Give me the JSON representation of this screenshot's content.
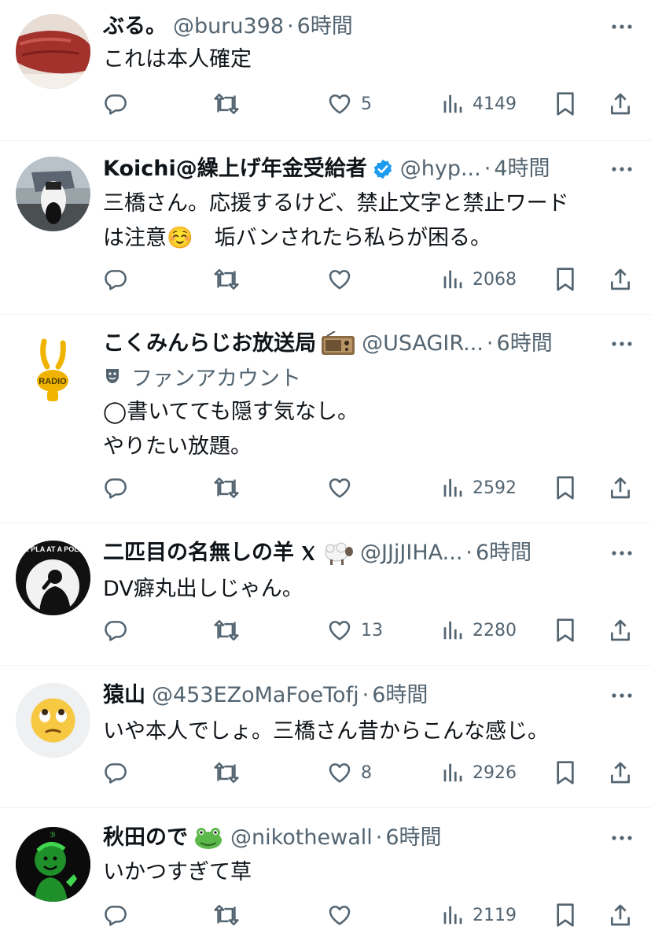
{
  "tweets": [
    {
      "name": "ぶる。",
      "handle": "@buru398",
      "separator": "·",
      "time": "6時間",
      "badge": "",
      "text": "これは本人確定",
      "likes": "5",
      "views": "4149",
      "avatar_icon": "meat-photo-avatar"
    },
    {
      "name": "Koichi@繰上げ年金受給者",
      "handle": "@hyp...",
      "separator": "·",
      "time": "4時間",
      "badge": "verified-badge-icon",
      "text": "三橋さん。応援するけど、禁止文字と禁止ワード\nは注意☺️　垢バンされたら私らが困る。",
      "likes": "",
      "views": "2068",
      "avatar_icon": "motorcycle-photo-avatar"
    },
    {
      "name": "こくみんらじお放送局",
      "handle": "@USAGIR...",
      "separator": "·",
      "time": "6時間",
      "badge": "radio-emoji",
      "fan_label": "ファンアカウント",
      "text": "◯書いてても隠す気なし。\nやりたい放題。",
      "likes": "",
      "views": "2592",
      "avatar_icon": "rabbit-radio-avatar",
      "avatar_text": "RADIO"
    },
    {
      "name": "二匹目の名無しの羊",
      "handle": "@JJjJIHA...",
      "separator": "·",
      "time": "6時間",
      "badge": "x-logo sheep-emoji",
      "text": "DV癖丸出しじゃん。",
      "likes": "13",
      "views": "2280",
      "avatar_icon": "politician-silhouette-avatar",
      "avatar_text": "E OUR PLA  AT A POLITICIA"
    },
    {
      "name": "猿山",
      "handle": "@453EZoMaFoeTofj",
      "separator": "·",
      "time": "6時間",
      "badge": "",
      "text": "いや本人でしょ。三橋さん昔からこんな感じ。",
      "likes": "8",
      "views": "2926",
      "avatar_icon": "eye-roll-emoji-avatar"
    },
    {
      "name": "秋田ので",
      "handle": "@nikothewall",
      "separator": "·",
      "time": "6時間",
      "badge": "frog-emoji",
      "text": "いかつすぎて草",
      "likes": "",
      "views": "2119",
      "avatar_icon": "green-vault-boy-avatar",
      "avatar_text": "ℬ"
    }
  ],
  "colors": {
    "text": "#0f1419",
    "muted": "#536471",
    "verified": "#1d9bf0",
    "separator": "#eff3f4"
  }
}
